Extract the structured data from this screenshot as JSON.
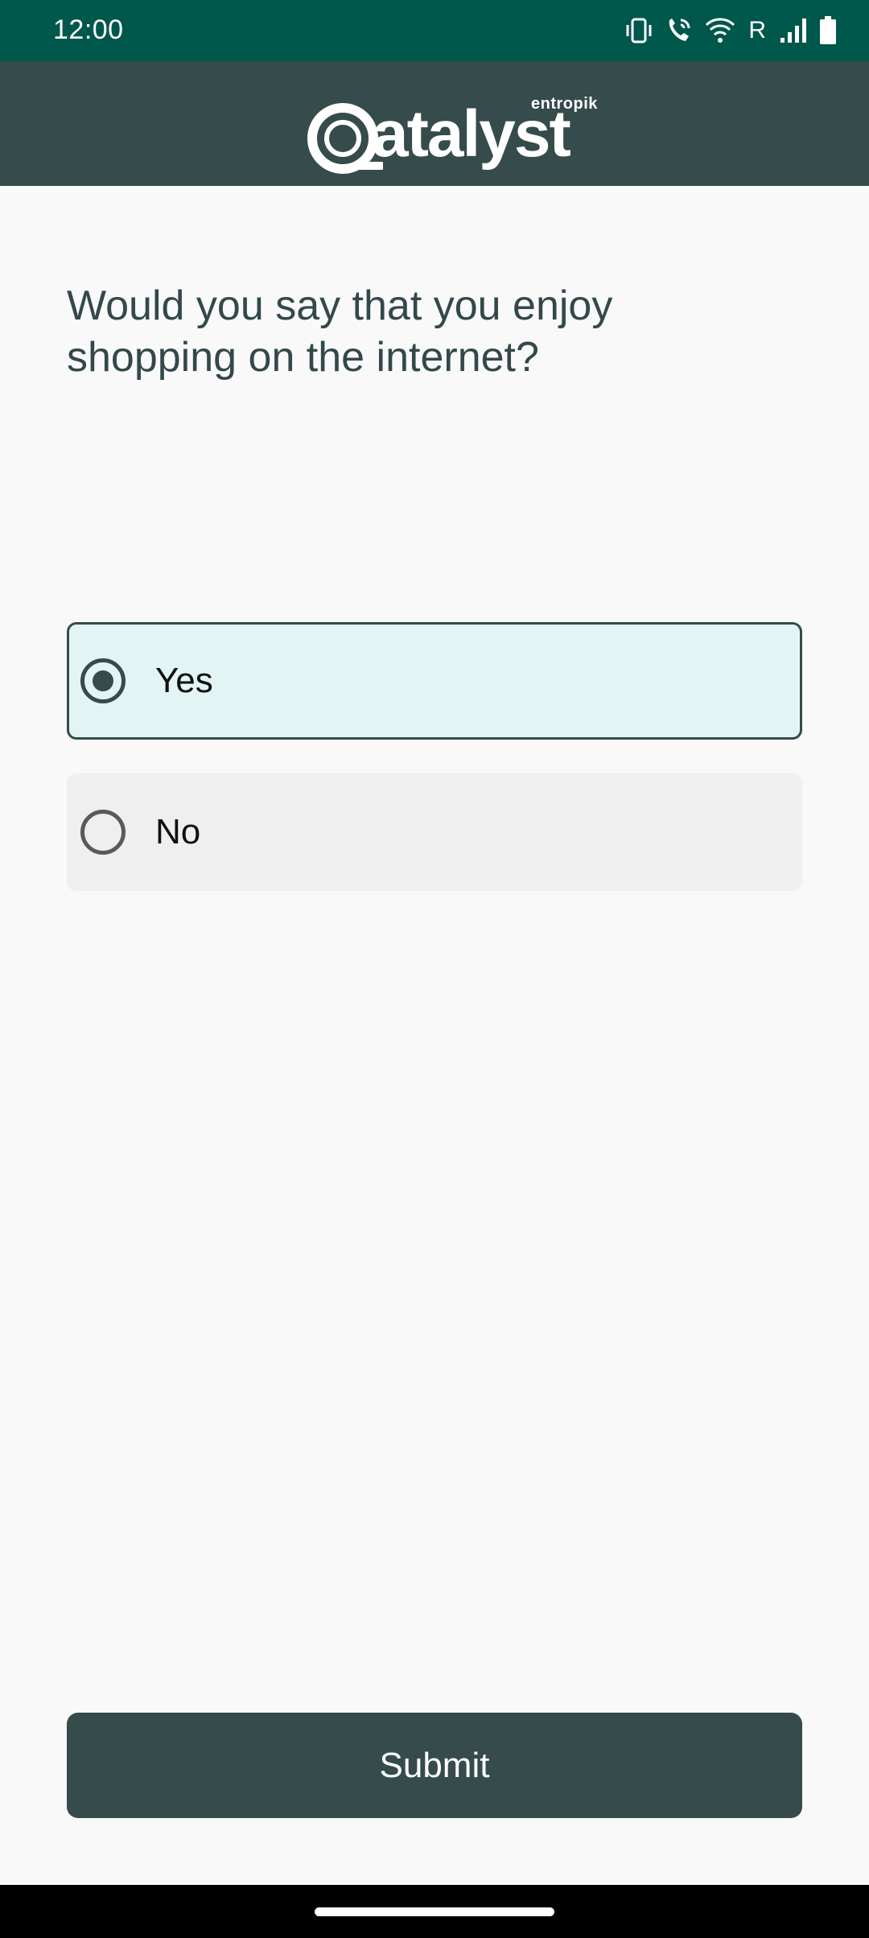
{
  "status_bar": {
    "time": "12:00",
    "roaming_indicator": "R",
    "icons": [
      "vibrate-icon",
      "wifi-calling-icon",
      "wifi-icon",
      "signal-icon",
      "battery-icon"
    ]
  },
  "header": {
    "brand_sup": "entropik",
    "brand_name": "atalyst",
    "brand_full": "Qatalyst"
  },
  "survey": {
    "question": "Would you say that you enjoy shopping on the internet?",
    "options": [
      {
        "label": "Yes",
        "selected": true
      },
      {
        "label": "No",
        "selected": false
      }
    ],
    "submit_label": "Submit"
  },
  "colors": {
    "status_bar": "#00574b",
    "header": "#354b4c",
    "accent": "#354b4c",
    "selected_option_bg": "#e2f4f4",
    "unselected_option_bg": "#efefef"
  }
}
